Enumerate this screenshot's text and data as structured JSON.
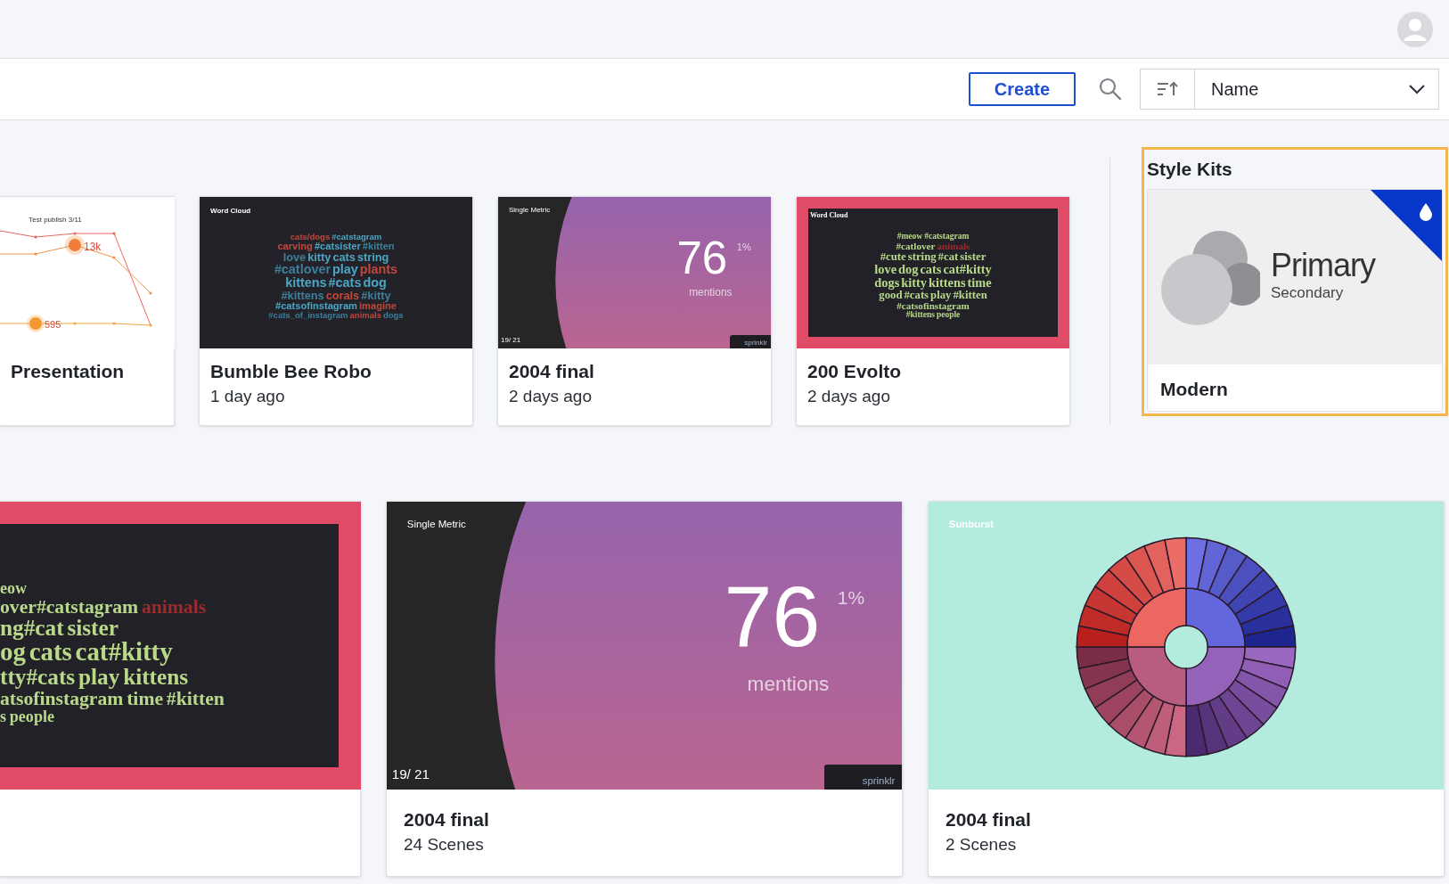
{
  "toolbar": {
    "create_label": "Create",
    "sort_value": "Name"
  },
  "recent": [
    {
      "title": "Presentation",
      "thumbnail": {
        "kind": "line_chart",
        "title": "Test publish 3/11",
        "callouts": [
          "13k",
          "595"
        ]
      }
    },
    {
      "title": "Bumble Bee Robo",
      "subtitle": "1 day ago",
      "thumbnail": {
        "kind": "word_cloud",
        "framed": false,
        "heading": "Word Cloud",
        "lines": [
          [
            {
              "text": "cats/dogs",
              "color": "#c2473b"
            },
            {
              "text": "#catstagram",
              "color": "#4ba6c4"
            }
          ],
          [
            {
              "text": "carving",
              "color": "#c2473b"
            },
            {
              "text": "#catsister",
              "color": "#4ba6c4"
            },
            {
              "text": "#kitten",
              "color": "#3e7f9a"
            }
          ],
          [
            {
              "text": "love",
              "color": "#3e7f9a"
            },
            {
              "text": "kitty",
              "color": "#4ba6c4"
            },
            {
              "text": "cats",
              "color": "#4ba6c4"
            },
            {
              "text": "string",
              "color": "#4ba6c4"
            }
          ],
          [
            {
              "text": "#catlover",
              "color": "#3e7f9a"
            },
            {
              "text": "play",
              "color": "#4ba6c4"
            },
            {
              "text": "plants",
              "color": "#c2473b"
            }
          ],
          [
            {
              "text": "kittens",
              "color": "#4ba6c4"
            },
            {
              "text": "#cats",
              "color": "#4ba6c4"
            },
            {
              "text": "dog",
              "color": "#4ba6c4"
            }
          ],
          [
            {
              "text": "#kittens",
              "color": "#3e7f9a"
            },
            {
              "text": "corals",
              "color": "#c2473b"
            },
            {
              "text": "#kitty",
              "color": "#3e7f9a"
            }
          ],
          [
            {
              "text": "#catsofinstagram",
              "color": "#4ba6c4"
            },
            {
              "text": "imagine",
              "color": "#c2473b"
            }
          ],
          [
            {
              "text": "#cats_of_instagram",
              "color": "#3e7f9a"
            },
            {
              "text": "animals",
              "color": "#c2473b"
            },
            {
              "text": "dogs",
              "color": "#3e7f9a"
            }
          ]
        ]
      }
    },
    {
      "title": "2004 final",
      "subtitle": "2 days ago",
      "thumbnail": {
        "kind": "single_metric",
        "heading": "Single Metric",
        "value": "76",
        "change": "1%",
        "unit": "mentions",
        "page": "19/ 21",
        "logo": "sprinklr"
      }
    },
    {
      "title": "200 Evolto",
      "subtitle": "2 days ago",
      "thumbnail": {
        "kind": "word_cloud",
        "framed": true,
        "heading": "Word Cloud",
        "lines": [
          [
            {
              "text": "#meow",
              "color": "#b8d98a"
            },
            {
              "text": "#catstagram",
              "color": "#b8d98a"
            }
          ],
          [
            {
              "text": "#catlover",
              "color": "#b8d98a"
            },
            {
              "text": "animals",
              "color": "#9c2b2b"
            }
          ],
          [
            {
              "text": "#cute",
              "color": "#b8d98a"
            },
            {
              "text": "string",
              "color": "#b8d98a"
            },
            {
              "text": "#cat",
              "color": "#b8d98a"
            },
            {
              "text": "sister",
              "color": "#b8d98a"
            }
          ],
          [
            {
              "text": "love",
              "color": "#b8d98a"
            },
            {
              "text": "dog",
              "color": "#b8d98a"
            },
            {
              "text": "cats",
              "color": "#b8d98a"
            },
            {
              "text": "cat#kitty",
              "color": "#b8d98a"
            }
          ],
          [
            {
              "text": "dogs",
              "color": "#b8d98a"
            },
            {
              "text": "kitty",
              "color": "#b8d98a"
            },
            {
              "text": "kittens",
              "color": "#b8d98a"
            },
            {
              "text": "time",
              "color": "#b8d98a"
            }
          ],
          [
            {
              "text": "good",
              "color": "#b8d98a"
            },
            {
              "text": "#cats",
              "color": "#b8d98a"
            },
            {
              "text": "play",
              "color": "#b8d98a"
            },
            {
              "text": "#kitten",
              "color": "#b8d98a"
            }
          ],
          [
            {
              "text": "#catsofinstagram",
              "color": "#b8d98a"
            }
          ],
          [
            {
              "text": "#kittens",
              "color": "#b8d98a"
            },
            {
              "text": "people",
              "color": "#b8d98a"
            }
          ]
        ]
      }
    }
  ],
  "style_kits": {
    "title": "Style Kits",
    "kits": [
      {
        "primary": "Primary",
        "secondary": "Secondary",
        "name": "Modern",
        "selected": true
      }
    ]
  },
  "projects": [
    {
      "thumbnail": {
        "kind": "word_cloud",
        "framed": true,
        "lines": [
          [
            {
              "text": "eow",
              "color": "#b8d98a"
            }
          ],
          [
            {
              "text": "over#catstagram",
              "color": "#b8d98a"
            },
            {
              "text": "animals",
              "color": "#9c2b2b"
            }
          ],
          [
            {
              "text": "ng#cat",
              "color": "#b8d98a"
            },
            {
              "text": "sister",
              "color": "#b8d98a"
            }
          ],
          [
            {
              "text": "og",
              "color": "#b8d98a"
            },
            {
              "text": "cats",
              "color": "#b8d98a"
            },
            {
              "text": "cat#kitty",
              "color": "#b8d98a"
            }
          ],
          [
            {
              "text": "tty#cats",
              "color": "#b8d98a"
            },
            {
              "text": "play",
              "color": "#b8d98a"
            },
            {
              "text": "kittens",
              "color": "#b8d98a"
            }
          ],
          [
            {
              "text": "atsofinstagram",
              "color": "#b8d98a"
            },
            {
              "text": "time",
              "color": "#b8d98a"
            },
            {
              "text": "#kitten",
              "color": "#b8d98a"
            }
          ],
          [
            {
              "text": "s",
              "color": "#b8d98a"
            },
            {
              "text": "people",
              "color": "#b8d98a"
            }
          ]
        ]
      }
    },
    {
      "title": "2004 final",
      "subtitle": "24 Scenes",
      "thumbnail": {
        "kind": "single_metric",
        "heading": "Single Metric",
        "value": "76",
        "change": "1%",
        "unit": "mentions",
        "page": "19/ 21",
        "logo": "sprinklr"
      }
    },
    {
      "title": "2004 final",
      "subtitle": "2 Scenes",
      "thumbnail": {
        "kind": "sunburst",
        "heading": "Sunburst"
      }
    }
  ]
}
